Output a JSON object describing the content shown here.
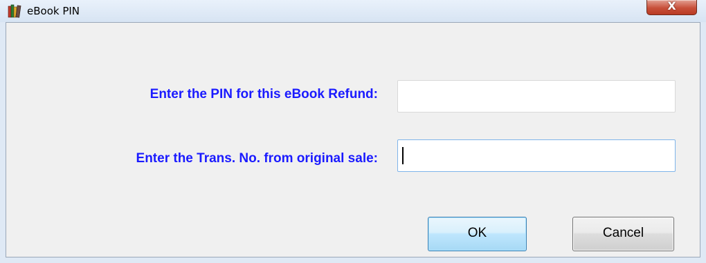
{
  "window": {
    "title": "eBook PIN",
    "close_label": "X"
  },
  "form": {
    "pin_label": "Enter the PIN for this eBook Refund:",
    "pin_value": "",
    "trans_label": "Enter the Trans. No. from original sale:",
    "trans_value": ""
  },
  "buttons": {
    "ok_label": "OK",
    "cancel_label": "Cancel"
  },
  "colors": {
    "label_text": "#1a1aff",
    "focus_border": "#7eb4ea"
  },
  "icons": {
    "app": "books-icon",
    "close": "close-icon"
  }
}
